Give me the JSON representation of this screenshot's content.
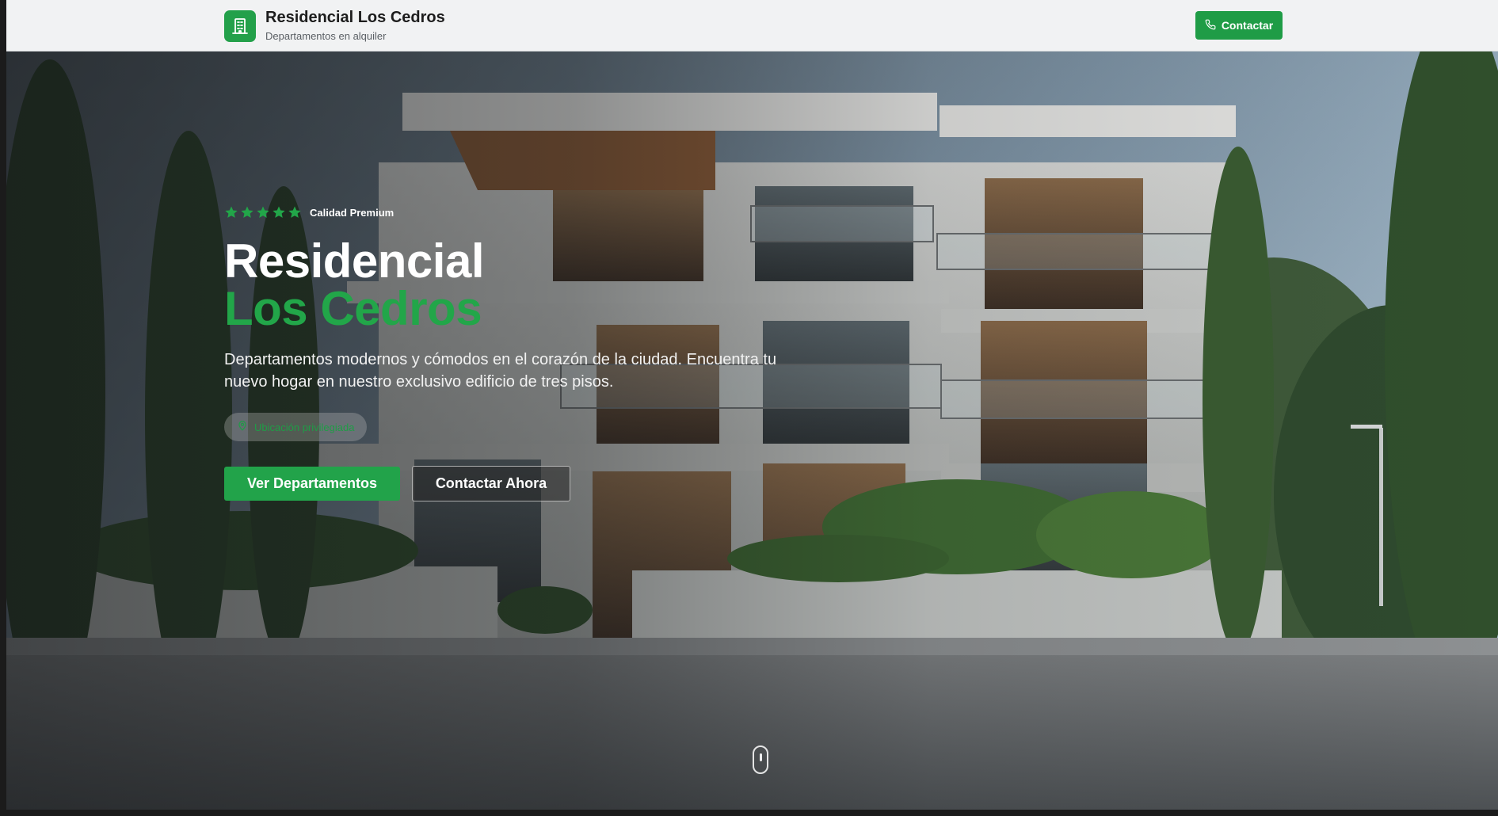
{
  "header": {
    "logo_icon": "building-icon",
    "title": "Residencial Los Cedros",
    "subtitle": "Departamentos en alquiler",
    "contact_label": "Contactar",
    "contact_icon": "phone-icon"
  },
  "hero": {
    "rating_stars": 5,
    "rating_label": "Calidad Premium",
    "title_line1": "Residencial",
    "title_line2": "Los Cedros",
    "description": "Departamentos modernos y cómodos en el corazón de la ciudad. Encuentra tu nuevo hogar en nuestro exclusivo edificio de tres pisos.",
    "location_label": "Ubicación privilegiada",
    "location_icon": "map-pin-icon",
    "primary_button": "Ver Departamentos",
    "secondary_button": "Contactar Ahora",
    "scroll_icon": "mouse-scroll-icon"
  },
  "colors": {
    "accent": "#22a34a",
    "header_bg": "#f1f2f3",
    "title_text": "#ffffff",
    "title_accent": "#22a649"
  }
}
